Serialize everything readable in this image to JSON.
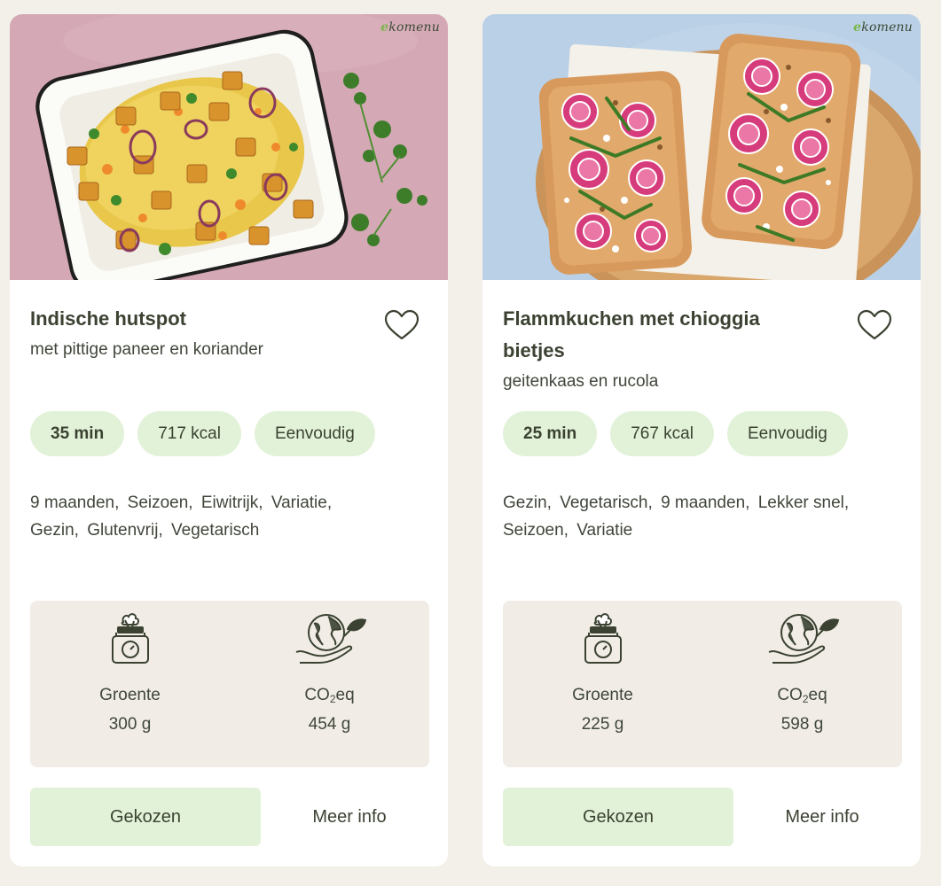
{
  "colors": {
    "page_bg": "#f3efe9",
    "pill_bg": "#e2f2d8",
    "stats_bg": "#f1ede6",
    "text": "#3b4232",
    "brand_accent": "#7ab648"
  },
  "recipes": [
    {
      "brand": {
        "accent": "e",
        "rest": "komenu"
      },
      "title": "Indische hutspot",
      "subtitle": "met pittige paneer en koriander",
      "pills": [
        "35 min",
        "717 kcal",
        "Eenvoudig"
      ],
      "tags": [
        "9 maanden,",
        "Seizoen,",
        "Eiwitrijk,",
        "Variatie,",
        "Gezin,",
        "Glutenvrij,",
        "Vegetarisch"
      ],
      "stats": {
        "veg_label": "Groente",
        "veg_value": "300 g",
        "co2_label_main": "CO",
        "co2_label_sub": "2",
        "co2_label_tail": "eq",
        "co2_value": "454 g",
        "veg_icon": "scale-vegetables-icon",
        "co2_icon": "globe-hand-leaf-icon"
      },
      "chosen_label": "Gekozen",
      "info_label": "Meer info",
      "favorite_icon": "heart-outline-icon"
    },
    {
      "brand": {
        "accent": "e",
        "rest": "komenu"
      },
      "title": "Flammkuchen met chioggia bietjes",
      "subtitle": "geitenkaas en rucola",
      "pills": [
        "25 min",
        "767 kcal",
        "Eenvoudig"
      ],
      "tags": [
        "Gezin,",
        "Vegetarisch,",
        "9 maanden,",
        "Lekker snel,",
        "Seizoen,",
        "Variatie"
      ],
      "stats": {
        "veg_label": "Groente",
        "veg_value": "225 g",
        "co2_label_main": "CO",
        "co2_label_sub": "2",
        "co2_label_tail": "eq",
        "co2_value": "598 g",
        "veg_icon": "scale-vegetables-icon",
        "co2_icon": "globe-hand-leaf-icon"
      },
      "chosen_label": "Gekozen",
      "info_label": "Meer info",
      "favorite_icon": "heart-outline-icon"
    }
  ]
}
